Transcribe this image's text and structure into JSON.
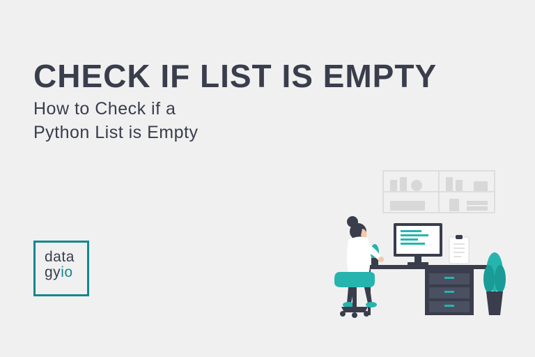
{
  "title": "CHECK IF LIST IS EMPTY",
  "subtitle_line1": "How to Check if a",
  "subtitle_line2": "Python List is Empty",
  "logo": {
    "line1": "data",
    "line2": "gy",
    "line3": "io"
  }
}
